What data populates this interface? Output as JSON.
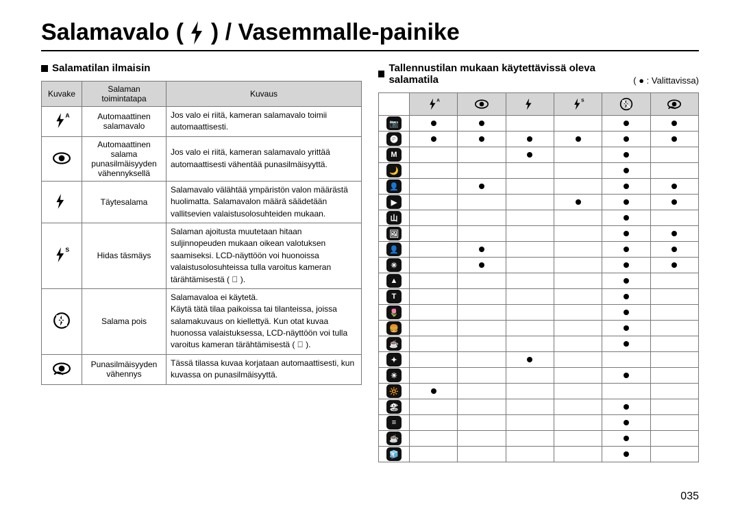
{
  "title_before": "Salamavalo (",
  "title_after": ") / Vasemmalle-painike",
  "page_number": "035",
  "left": {
    "heading": "Salamatilan ilmaisin",
    "headers": {
      "c1": "Kuvake",
      "c2": "Salaman\ntoimintatapa",
      "c3": "Kuvaus"
    },
    "rows": [
      {
        "icon": "flash-auto",
        "name": "Automaattinen salamavalo",
        "desc": "Jos valo ei riitä, kameran salamavalo toimii automaattisesti."
      },
      {
        "icon": "redeye",
        "name": "Automaattinen salama punasilmäisyyden vähennyksellä",
        "desc": "Jos valo ei riitä, kameran salamavalo yrittää automaattisesti vähentää punasilmäisyyttä."
      },
      {
        "icon": "flash",
        "name": "Täytesalama",
        "desc": "Salamavalo välähtää ympäristön valon määrästä huolimatta. Salamavalon määrä säädetään vallitsevien valaistusolosuhteiden mukaan."
      },
      {
        "icon": "flash-s",
        "name": "Hidas täsmäys",
        "desc": "Salaman ajoitusta muutetaan hitaan suljinnopeuden mukaan oikean valotuksen saamiseksi. LCD-näyttöön voi huonoissa valaistusolosuhteissa tulla varoitus  kameran tärähtämisestä ( 󰄛 )."
      },
      {
        "icon": "flash-off",
        "name": "Salama pois",
        "desc": "Salamavaloa ei käytetä.\nKäytä tätä tilaa paikoissa tai tilanteissa, joissa salamakuvaus on kiellettyä. Kun otat kuvaa huonossa valaistuksessa, LCD-näyttöön voi tulla varoitus kameran tärähtämisestä ( 󰄛 )."
      },
      {
        "icon": "redeye-fix",
        "name": "Punasilmäisyyden vähennys",
        "desc": "Tässä tilassa kuvaa korjataan automaattisesti, kun kuvassa on punasilmäisyyttä."
      }
    ]
  },
  "right": {
    "heading": "Tallennustilan mukaan käytettävissä oleva salamatila",
    "legend": "( ● : Valittavissa)",
    "col_icons": [
      "flash-auto",
      "redeye",
      "flash",
      "flash-s",
      "flash-off",
      "redeye-fix"
    ],
    "row_labels": [
      "📷",
      "🅟",
      "M",
      "🌙",
      "👤",
      "▶",
      "山",
      "🖼",
      "👤",
      "✳",
      "▲",
      "T",
      "🌷",
      "🍔",
      "☕",
      "✦",
      "☀",
      "🔆",
      "🏖",
      "≡",
      "☕",
      "🧊"
    ],
    "chart_data": {
      "type": "table",
      "columns": [
        "flash-auto",
        "redeye",
        "flash",
        "flash-s",
        "flash-off",
        "redeye-fix"
      ],
      "matrix": [
        [
          1,
          1,
          0,
          0,
          1,
          1
        ],
        [
          1,
          1,
          1,
          1,
          1,
          1
        ],
        [
          0,
          0,
          1,
          0,
          1,
          0
        ],
        [
          0,
          0,
          0,
          0,
          1,
          0
        ],
        [
          0,
          1,
          0,
          0,
          1,
          1
        ],
        [
          0,
          0,
          0,
          1,
          1,
          1
        ],
        [
          0,
          0,
          0,
          0,
          1,
          0
        ],
        [
          0,
          0,
          0,
          0,
          1,
          1
        ],
        [
          0,
          1,
          0,
          0,
          1,
          1
        ],
        [
          0,
          1,
          0,
          0,
          1,
          1
        ],
        [
          0,
          0,
          0,
          0,
          1,
          0
        ],
        [
          0,
          0,
          0,
          0,
          1,
          0
        ],
        [
          0,
          0,
          0,
          0,
          1,
          0
        ],
        [
          0,
          0,
          0,
          0,
          1,
          0
        ],
        [
          0,
          0,
          0,
          0,
          1,
          0
        ],
        [
          0,
          0,
          1,
          0,
          0,
          0
        ],
        [
          0,
          0,
          0,
          0,
          1,
          0
        ],
        [
          1,
          0,
          0,
          0,
          0,
          0
        ],
        [
          0,
          0,
          0,
          0,
          1,
          0
        ],
        [
          0,
          0,
          0,
          0,
          1,
          0
        ],
        [
          0,
          0,
          0,
          0,
          1,
          0
        ],
        [
          0,
          0,
          0,
          0,
          1,
          0
        ]
      ]
    }
  }
}
